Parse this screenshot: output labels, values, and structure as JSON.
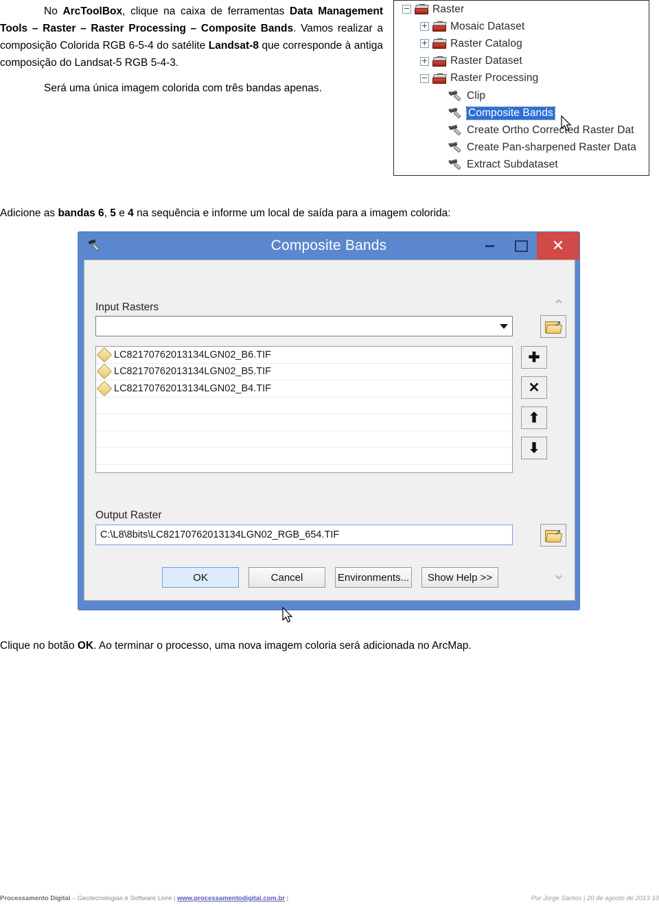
{
  "document": {
    "paragraphs": [
      {
        "id": "p1",
        "segments": [
          {
            "text": "No ",
            "bold": false
          },
          {
            "text": "ArcToolBox",
            "bold": true
          },
          {
            "text": ", clique na caixa de ferramentas ",
            "bold": false
          },
          {
            "text": "Data Management Tools – Raster – Raster Processing – Composite Bands",
            "bold": true
          },
          {
            "text": ". Vamos realizar a composição Colorida RGB 6-5-4 do satélite ",
            "bold": false
          },
          {
            "text": "Landsat-8",
            "bold": true
          },
          {
            "text": " que corresponde à antiga composição do Landsat-5 RGB 5-4-3.",
            "bold": false
          }
        ]
      },
      {
        "id": "p2",
        "segments": [
          {
            "text": "Será uma única imagem colorida com três bandas apenas.",
            "bold": false
          }
        ]
      }
    ],
    "mid_instruction": [
      {
        "text": "Adicione as ",
        "bold": false
      },
      {
        "text": "bandas 6",
        "bold": true
      },
      {
        "text": ", ",
        "bold": false
      },
      {
        "text": "5",
        "bold": true
      },
      {
        "text": " e ",
        "bold": false
      },
      {
        "text": "4",
        "bold": true
      },
      {
        "text": " na sequência e informe um local de saída para a imagem colorida:",
        "bold": false
      }
    ],
    "bottom_instruction": [
      {
        "text": "Clique no botão ",
        "bold": false
      },
      {
        "text": "OK",
        "bold": true
      },
      {
        "text": ". Ao terminar o processo, uma nova imagem coloria será adicionada no ArcMap.",
        "bold": false
      }
    ]
  },
  "toolbox_tree": {
    "nodes": [
      {
        "label": "Raster",
        "indent": 0,
        "expander": "minus",
        "icon": "toolbox-icon",
        "selected": false
      },
      {
        "label": "Mosaic Dataset",
        "indent": 1,
        "expander": "plus",
        "icon": "toolbox-icon",
        "selected": false
      },
      {
        "label": "Raster Catalog",
        "indent": 1,
        "expander": "plus",
        "icon": "toolbox-icon",
        "selected": false
      },
      {
        "label": "Raster Dataset",
        "indent": 1,
        "expander": "plus",
        "icon": "toolbox-icon",
        "selected": false
      },
      {
        "label": "Raster Processing",
        "indent": 1,
        "expander": "minus",
        "icon": "toolbox-icon",
        "selected": false
      },
      {
        "label": "Clip",
        "indent": 2,
        "expander": "none",
        "icon": "hammer-icon",
        "selected": false
      },
      {
        "label": "Composite Bands",
        "indent": 2,
        "expander": "none",
        "icon": "hammer-icon",
        "selected": true
      },
      {
        "label": "Create Ortho Corrected Raster Dat",
        "indent": 2,
        "expander": "none",
        "icon": "hammer-icon",
        "selected": false
      },
      {
        "label": "Create Pan-sharpened Raster Data",
        "indent": 2,
        "expander": "none",
        "icon": "hammer-icon",
        "selected": false
      },
      {
        "label": "Extract Subdataset",
        "indent": 2,
        "expander": "none",
        "icon": "hammer-icon",
        "selected": false
      }
    ]
  },
  "dialog": {
    "title": "Composite Bands",
    "titlebar": {
      "minimize_label": "",
      "maximize_label": "",
      "close_label": "✕"
    },
    "input_rasters": {
      "label": "Input Rasters",
      "combo_value": "",
      "combo_placeholder": "",
      "items": [
        "LC82170762013134LGN02_B6.TIF",
        "LC82170762013134LGN02_B5.TIF",
        "LC82170762013134LGN02_B4.TIF"
      ],
      "browse_label": "open-folder"
    },
    "side_buttons": [
      {
        "name": "add-button",
        "glyph": "✚"
      },
      {
        "name": "remove-button",
        "glyph": "✕"
      },
      {
        "name": "move-up-button",
        "glyph": "⬆"
      },
      {
        "name": "move-down-button",
        "glyph": "⬇"
      }
    ],
    "output_raster": {
      "label": "Output Raster",
      "value": "C:\\L8\\8bits\\LC82170762013134LGN02_RGB_654.TIF",
      "browse_label": "open-folder"
    },
    "buttons": {
      "ok": "OK",
      "cancel": "Cancel",
      "environments": "Environments...",
      "show_help": "Show Help >>"
    },
    "scroll": {
      "up_glyph": "⌃",
      "down_glyph": "⌄"
    }
  },
  "footer": {
    "brand": "Processamento Digital",
    "tagline": " – Geotecnologias e Software Livre | ",
    "link": "www.processamentodigital.com.br",
    "trail": " |",
    "right": "Por Jorge Santos | 20 de agosto de 2013 10"
  },
  "colors": {
    "title_bar": "#5b87ce",
    "close_button": "#d04a47",
    "selection": "#2b6fd6",
    "dialog_body": "#f0f0f0",
    "link": "#5a5ac0"
  }
}
